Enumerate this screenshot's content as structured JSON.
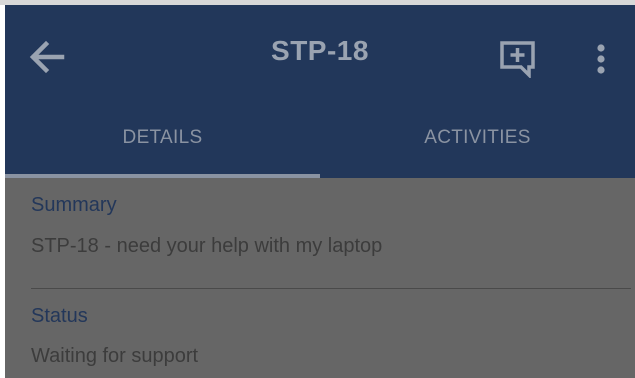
{
  "header": {
    "title": "STP-18",
    "back_icon": "arrow-left-icon",
    "add_comment_icon": "add-comment-icon",
    "more_icon": "more-vertical-icon"
  },
  "tabs": [
    {
      "label": "DETAILS",
      "active": true
    },
    {
      "label": "ACTIVITIES",
      "active": false
    }
  ],
  "fields": {
    "summary": {
      "label": "Summary",
      "value": "STP-18 - need your help with my laptop"
    },
    "status": {
      "label": "Status",
      "value": "Waiting for support"
    }
  },
  "colors": {
    "app_bar": "#22375a",
    "content_overlay": "#666666",
    "label_blue": "#23375a"
  }
}
